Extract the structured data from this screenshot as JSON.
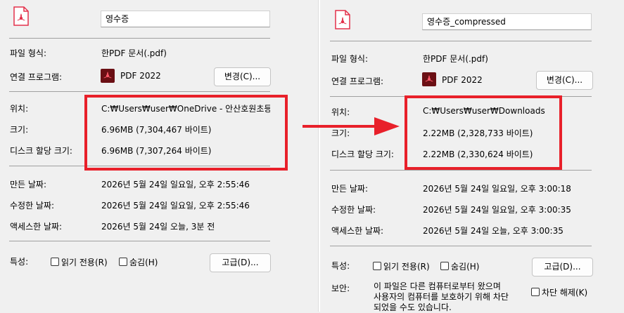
{
  "left": {
    "name": "영수증",
    "labels": {
      "type": "파일 형식:",
      "openwith": "연결 프로그램:",
      "location": "위치:",
      "size": "크기:",
      "disksize": "디스크 할당 크기:",
      "created": "만든 날짜:",
      "modified": "수정한 날짜:",
      "accessed": "액세스한 날짜:",
      "attributes": "특성:"
    },
    "type_value": "한PDF 문서(.pdf)",
    "app_name": "PDF 2022",
    "change_button": "변경(C)...",
    "location": "C:₩Users₩user₩OneDrive - 안산호원초등학교",
    "size": "6.96MB (7,304,467 바이트)",
    "disksize": "6.96MB (7,307,264 바이트)",
    "created": "2026년 5월 24일 일요일, 오후 2:55:46",
    "modified": "2026년 5월 24일 일요일, 오후 2:55:46",
    "accessed": "2026년 5월 24일 오늘, 3분 전",
    "readonly": "읽기 전용(R)",
    "hidden": "숨김(H)",
    "advanced_button": "고급(D)..."
  },
  "right": {
    "name": "영수증_compressed",
    "labels": {
      "type": "파일 형식:",
      "openwith": "연결 프로그램:",
      "location": "위치:",
      "size": "크기:",
      "disksize": "디스크 할당 크기:",
      "created": "만든 날짜:",
      "modified": "수정한 날짜:",
      "accessed": "액세스한 날짜:",
      "attributes": "특성:",
      "security": "보안:"
    },
    "type_value": "한PDF 문서(.pdf)",
    "app_name": "PDF 2022",
    "change_button": "변경(C)...",
    "location": "C:₩Users₩user₩Downloads",
    "size": "2.22MB (2,328,733 바이트)",
    "disksize": "2.22MB (2,330,624 바이트)",
    "created": "2026년 5월 24일 일요일, 오후 3:00:18",
    "modified": "2026년 5월 24일 일요일, 오후 3:00:35",
    "accessed": "2026년 5월 24일 오늘, 오후 3:00:35",
    "readonly": "읽기 전용(R)",
    "hidden": "숨김(H)",
    "advanced_button": "고급(D)...",
    "security_lines": [
      "이 파일은 다른 컴퓨터로부터 왔으며",
      "사용자의 컴퓨터를 보호하기 위해 차단",
      "되었을 수도 있습니다."
    ],
    "unblock": "차단 해제(K)"
  },
  "colors": {
    "highlight": "#e8202a",
    "pdf_brand": "#e3304a"
  },
  "icons": {
    "file": "pdf-file-icon",
    "app": "pdf-app-icon",
    "arrow": "red-arrow-icon"
  }
}
